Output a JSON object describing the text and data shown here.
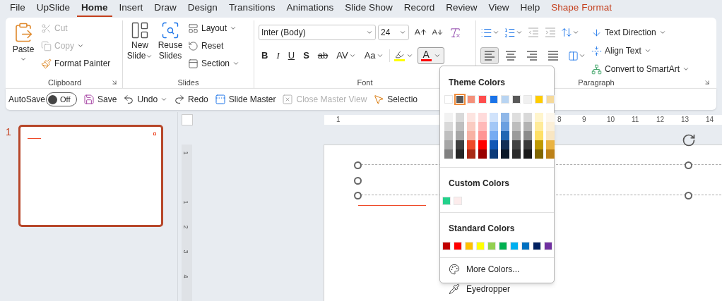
{
  "tabs": [
    {
      "label": "File",
      "selected": false,
      "kind": "normal"
    },
    {
      "label": "UpSlide",
      "selected": false,
      "kind": "normal"
    },
    {
      "label": "Home",
      "selected": true,
      "kind": "normal"
    },
    {
      "label": "Insert",
      "selected": false,
      "kind": "normal"
    },
    {
      "label": "Draw",
      "selected": false,
      "kind": "normal"
    },
    {
      "label": "Design",
      "selected": false,
      "kind": "normal"
    },
    {
      "label": "Transitions",
      "selected": false,
      "kind": "normal"
    },
    {
      "label": "Animations",
      "selected": false,
      "kind": "normal"
    },
    {
      "label": "Slide Show",
      "selected": false,
      "kind": "normal"
    },
    {
      "label": "Record",
      "selected": false,
      "kind": "normal"
    },
    {
      "label": "Review",
      "selected": false,
      "kind": "normal"
    },
    {
      "label": "View",
      "selected": false,
      "kind": "normal"
    },
    {
      "label": "Help",
      "selected": false,
      "kind": "normal"
    },
    {
      "label": "Shape Format",
      "selected": false,
      "kind": "contextual"
    }
  ],
  "ribbon": {
    "clipboard": {
      "label": "Clipboard",
      "paste": "Paste",
      "items": [
        {
          "label": "Cut",
          "kind": "cut",
          "disabled": true,
          "caret": false
        },
        {
          "label": "Copy",
          "kind": "copy",
          "disabled": true,
          "caret": true
        },
        {
          "label": "Format Painter",
          "kind": "painter",
          "disabled": false,
          "caret": false
        }
      ]
    },
    "slides": {
      "label": "Slides",
      "new_slide": [
        "New",
        "Slide"
      ],
      "reuse_slides": [
        "Reuse",
        "Slides"
      ],
      "items": [
        {
          "label": "Layout",
          "kind": "layout",
          "caret": true
        },
        {
          "label": "Reset",
          "kind": "reset",
          "caret": false
        },
        {
          "label": "Section",
          "kind": "section",
          "caret": true
        }
      ]
    },
    "font": {
      "label": "Font",
      "font_name": "Inter (Body)",
      "font_size": "24",
      "format_buttons": [
        {
          "label": "B",
          "kind": "bold"
        },
        {
          "label": "I",
          "kind": "italic"
        },
        {
          "label": "U",
          "kind": "underline"
        },
        {
          "label": "S",
          "kind": "shadow"
        },
        {
          "label": "ab",
          "kind": "strike"
        },
        {
          "label": "AV",
          "kind": "spacing"
        },
        {
          "label": "Aa",
          "kind": "case"
        }
      ],
      "highlight": {
        "color": "#ffff00"
      },
      "font_color": {
        "letter": "A",
        "color": "#ff0000",
        "expanded": true
      }
    },
    "paragraph": {
      "label": "Paragraph",
      "alignment": [
        {
          "kind": "left",
          "selected": true
        },
        {
          "kind": "center",
          "selected": false
        },
        {
          "kind": "right",
          "selected": false
        },
        {
          "kind": "justify",
          "selected": false
        }
      ],
      "indent": [
        {
          "kind": "decrease",
          "disabled": true
        },
        {
          "kind": "increase",
          "disabled": true
        }
      ],
      "commands": [
        {
          "label": "Text Direction",
          "kind": "direction"
        },
        {
          "label": "Align Text",
          "kind": "align"
        },
        {
          "label": "Convert to SmartArt",
          "kind": "smartart"
        }
      ]
    }
  },
  "quick_access": {
    "autosave": {
      "label": "AutoSave",
      "state": "Off",
      "on": false
    },
    "buttons": [
      {
        "label": "Save",
        "kind": "save",
        "disabled": false,
        "caret": false
      },
      {
        "label": "Undo",
        "kind": "undo",
        "disabled": false,
        "caret": true
      },
      {
        "label": "Redo",
        "kind": "redo",
        "disabled": false,
        "caret": false
      },
      {
        "label": "Slide Master",
        "kind": "master",
        "disabled": false,
        "caret": false
      },
      {
        "label": "Close Master View",
        "kind": "close",
        "disabled": true,
        "caret": false
      },
      {
        "label": "Selectio",
        "kind": "selection",
        "disabled": false,
        "caret": false
      }
    ]
  },
  "slide_panel": {
    "slides": [
      {
        "number": "1",
        "selected": true
      }
    ]
  },
  "rulers": {
    "horizontal": [
      "1",
      "8",
      "9",
      "10",
      "11",
      "12",
      "13",
      "14"
    ],
    "vertical": [
      "1",
      "1",
      "2",
      "3",
      "4"
    ]
  },
  "color_menu": {
    "theme_title": "Theme Colors",
    "theme": [
      {
        "color": "#ffffff",
        "selected": false
      },
      {
        "color": "#595959",
        "selected": true
      },
      {
        "color": "#f4907a",
        "selected": false
      },
      {
        "color": "#ff4d4d",
        "selected": false
      },
      {
        "color": "#1a73e8",
        "selected": false
      },
      {
        "color": "#b8d4f2",
        "selected": false
      },
      {
        "color": "#595959",
        "selected": false
      },
      {
        "color": "#f0f0f0",
        "selected": false
      },
      {
        "color": "#ffcc00",
        "selected": false
      },
      {
        "color": "#f5d99a",
        "selected": false
      }
    ],
    "shades": [
      [
        {
          "color": "#f2f2f2"
        },
        {
          "color": "#d9d9d9"
        },
        {
          "color": "#bfbfbf"
        },
        {
          "color": "#a6a6a6"
        },
        {
          "color": "#808080"
        }
      ],
      [
        {
          "color": "#d9d9d9"
        },
        {
          "color": "#bfbfbf"
        },
        {
          "color": "#a6a6a6"
        },
        {
          "color": "#404040"
        },
        {
          "color": "#262626"
        }
      ],
      [
        {
          "color": "#fde4e0"
        },
        {
          "color": "#facbc1"
        },
        {
          "color": "#f8b1a3"
        },
        {
          "color": "#ee4a29"
        },
        {
          "color": "#a92914"
        }
      ],
      [
        {
          "color": "#ffdbdb"
        },
        {
          "color": "#ffb8b8"
        },
        {
          "color": "#ff9494"
        },
        {
          "color": "#ff0000"
        },
        {
          "color": "#990000"
        }
      ],
      [
        {
          "color": "#d1e3fb"
        },
        {
          "color": "#a3c7f6"
        },
        {
          "color": "#76abf2"
        },
        {
          "color": "#1258b6"
        },
        {
          "color": "#0c3b7a"
        }
      ],
      [
        {
          "color": "#8fb7e8"
        },
        {
          "color": "#6a9fe0"
        },
        {
          "color": "#2066b3"
        },
        {
          "color": "#142f55"
        },
        {
          "color": "#0a1829"
        }
      ],
      [
        {
          "color": "#dedede"
        },
        {
          "color": "#bdbdbd"
        },
        {
          "color": "#9b9b9b"
        },
        {
          "color": "#434343"
        },
        {
          "color": "#2c2c2c"
        }
      ],
      [
        {
          "color": "#d9d9d9"
        },
        {
          "color": "#b3b3b3"
        },
        {
          "color": "#8c8c8c"
        },
        {
          "color": "#3a3a3a"
        },
        {
          "color": "#1a1a1a"
        }
      ],
      [
        {
          "color": "#fff5cc"
        },
        {
          "color": "#ffeb99"
        },
        {
          "color": "#ffe066"
        },
        {
          "color": "#bf9900"
        },
        {
          "color": "#806600"
        }
      ],
      [
        {
          "color": "#fdf7ec"
        },
        {
          "color": "#fbefd7"
        },
        {
          "color": "#f9e6c2"
        },
        {
          "color": "#eab341"
        },
        {
          "color": "#bc8118"
        }
      ]
    ],
    "custom_title": "Custom Colors",
    "custom": [
      {
        "color": "#23d18b"
      },
      {
        "color": "#fcecec"
      }
    ],
    "standard_title": "Standard Colors",
    "standard": [
      {
        "color": "#c00000"
      },
      {
        "color": "#ff0000"
      },
      {
        "color": "#ffc000"
      },
      {
        "color": "#ffff00"
      },
      {
        "color": "#92d050"
      },
      {
        "color": "#00b050"
      },
      {
        "color": "#00b0f0"
      },
      {
        "color": "#0070c0"
      },
      {
        "color": "#002060"
      },
      {
        "color": "#7030a0"
      }
    ],
    "actions": [
      {
        "label": "More Colors...",
        "kind": "more"
      },
      {
        "label": "Eyedropper",
        "kind": "eyedropper"
      }
    ]
  }
}
